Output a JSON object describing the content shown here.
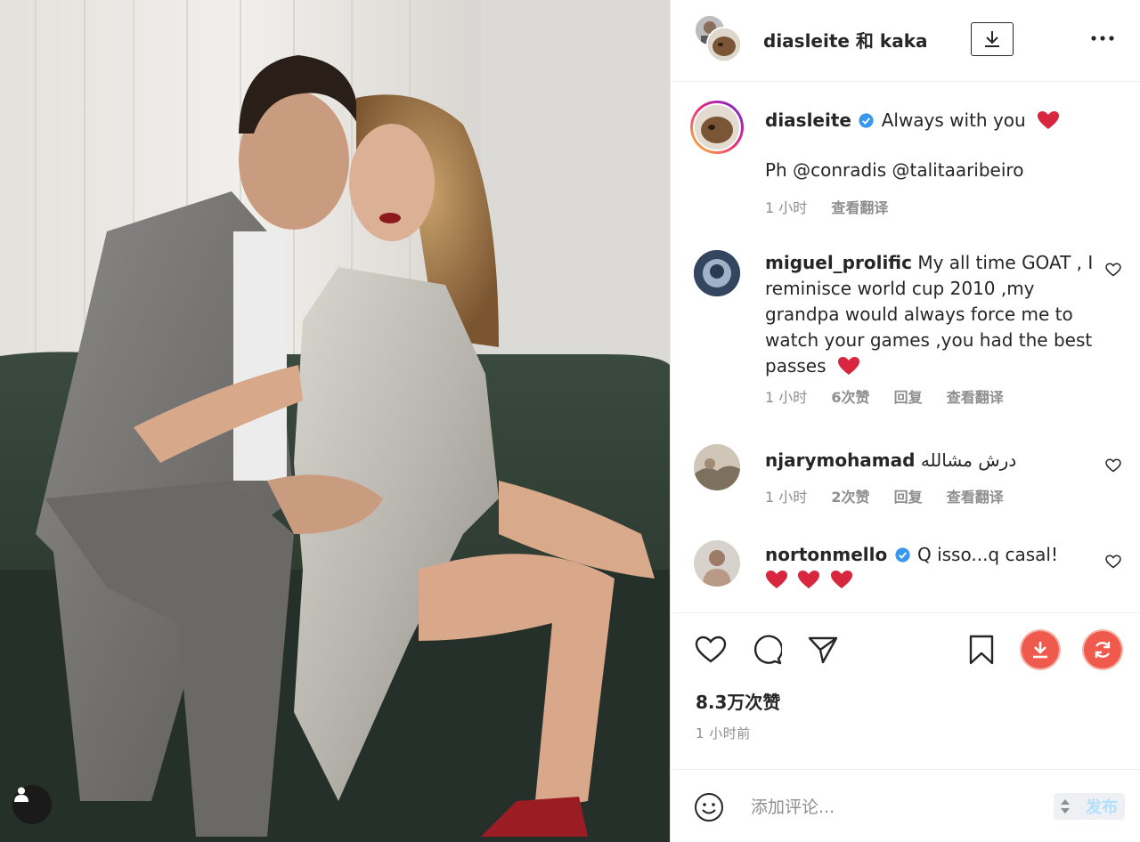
{
  "photo": {
    "alt": "",
    "tag_icon": "user-tag-icon"
  },
  "header": {
    "title": "diasleite 和 kaka",
    "download_icon": "download-icon",
    "more_icon": "more-horizontal-icon"
  },
  "caption": {
    "username": "diasleite",
    "text": "Always with you",
    "credit": "Ph @conradis @talitaaribeiro",
    "time": "1 小时",
    "translate": "查看翻译"
  },
  "comments": [
    {
      "username": "miguel_prolific",
      "text": "My all time GOAT , I reminisce world cup 2010 ,my grandpa would always force me to watch your games ,you had the best passes",
      "time": "1 小时",
      "likes": "6次赞",
      "reply": "回复",
      "translate": "查看翻译"
    },
    {
      "username": "njarymohamad",
      "text": "درش مشالله",
      "time": "1 小时",
      "likes": "2次赞",
      "reply": "回复",
      "translate": "查看翻译"
    },
    {
      "username": "nortonmello",
      "text": "Q isso...q casal!",
      "time": "",
      "likes": "",
      "reply": "",
      "translate": ""
    }
  ],
  "actions": {
    "likes_count": "8.3万次赞",
    "post_time": "1 小时前"
  },
  "compose": {
    "placeholder": "添加评论...",
    "post_label": "发布"
  },
  "colors": {
    "heart": "#ed4956",
    "verified": "#3897f0",
    "download_circle": "#ef5a4c",
    "text_secondary": "#8e8e8e"
  }
}
